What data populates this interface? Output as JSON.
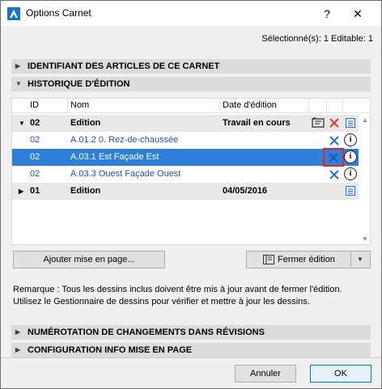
{
  "window": {
    "title": "Options Carnet",
    "help": "?",
    "close": "✕"
  },
  "selection_info": "Sélectionné(s): 1 Editable: 1",
  "sections": {
    "identifiant": "IDENTIFIANT DES ARTICLES DE CE CARNET",
    "historique": "HISTORIQUE D'ÉDITION",
    "numerotation": "NUMÉROTATION DE CHANGEMENTS DANS RÉVISIONS",
    "configuration": "CONFIGURATION INFO MISE EN PAGE"
  },
  "table": {
    "headers": {
      "id": "ID",
      "name": "Nom",
      "date": "Date d'édition"
    },
    "rows": [
      {
        "id": "02",
        "name": "Edition",
        "date": "Travail en cours",
        "type": "group",
        "expanded": true
      },
      {
        "id": "02",
        "name": "A.01.2 0. Rez-de-chaussée",
        "type": "item"
      },
      {
        "id": "02",
        "name": "A.03.1 Est Façade Est",
        "type": "item-selected"
      },
      {
        "id": "02",
        "name": "A.03.3 Ouest Façade Ouest",
        "type": "item"
      },
      {
        "id": "01",
        "name": "Edition",
        "date": "04/05/2016",
        "type": "group",
        "expanded": false
      }
    ]
  },
  "buttons": {
    "add_layout": "Ajouter mise en page...",
    "close_edition": "Fermer édition",
    "cancel": "Annuler",
    "ok": "OK"
  },
  "remark": {
    "line1": "Remarque : Tous les dessins inclus doivent être mis à jour avant de fermer l'édition.",
    "line2": "Utilisez le Gestionnaire de dessins pour vérifier et mettre à jour les dessins."
  },
  "colors": {
    "selection": "#2f7ed8",
    "link": "#2a4fb4",
    "delete_red": "#e53b2c",
    "delete_blue": "#2a6fd6",
    "highlight_box": "#e0262c"
  }
}
